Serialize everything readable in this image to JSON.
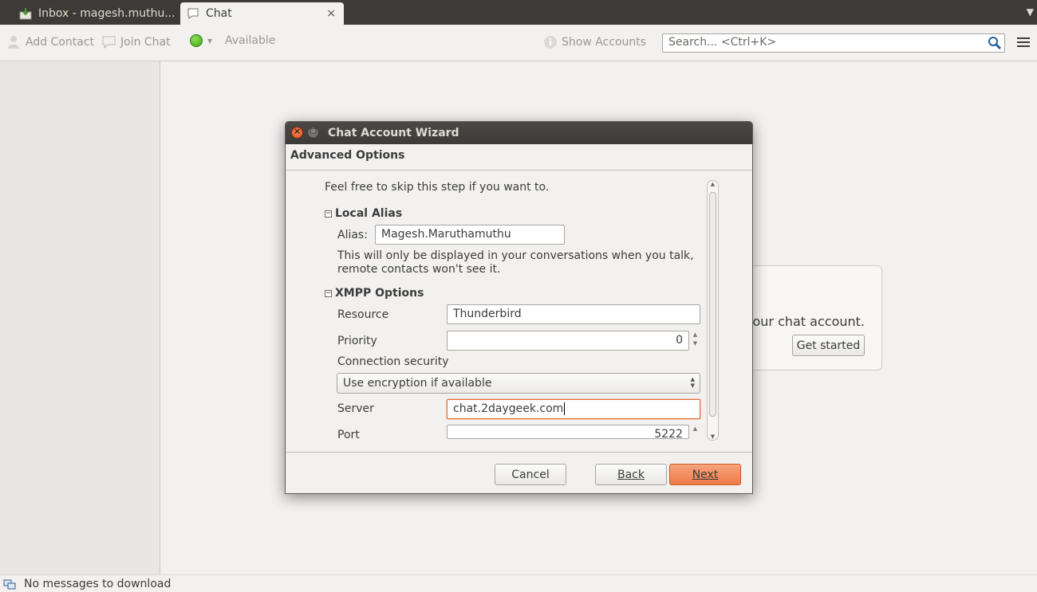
{
  "tabs": [
    {
      "label": "Inbox - magesh.muthu...",
      "icon": "inbox-icon"
    },
    {
      "label": "Chat",
      "icon": "chat-bubble-icon",
      "close": "×"
    }
  ],
  "toolbar": {
    "add_contact": "Add Contact",
    "join_chat": "Join Chat",
    "status": "Available",
    "status_color": "#3fa515",
    "show_accounts": "Show Accounts",
    "search_placeholder": "Search... <Ctrl+K>"
  },
  "start_panel": {
    "text": "your chat account.",
    "button": "Get started"
  },
  "statusbar": {
    "text": "No messages to download"
  },
  "dialog": {
    "title": "Chat Account Wizard",
    "header": "Advanced Options",
    "intro": "Feel free to skip this step if you want to.",
    "local_alias": {
      "section_title": "Local Alias",
      "toggle": "−",
      "alias_label": "Alias:",
      "alias_value": "Magesh.Maruthamuthu",
      "note_line1": "This will only be displayed in your conversations when you talk,",
      "note_line2": "remote contacts won't see it."
    },
    "xmpp": {
      "section_title": "XMPP Options",
      "toggle": "−",
      "resource_label": "Resource",
      "resource_value": "Thunderbird",
      "priority_label": "Priority",
      "priority_value": "0",
      "security_label": "Connection security",
      "security_value": "Use encryption if available",
      "server_label": "Server",
      "server_value": "chat.2daygeek.com",
      "port_label": "Port",
      "port_value": "5222"
    },
    "buttons": {
      "cancel": "Cancel",
      "back": "Back",
      "next": "Next"
    },
    "accent": "#ee7a48"
  }
}
